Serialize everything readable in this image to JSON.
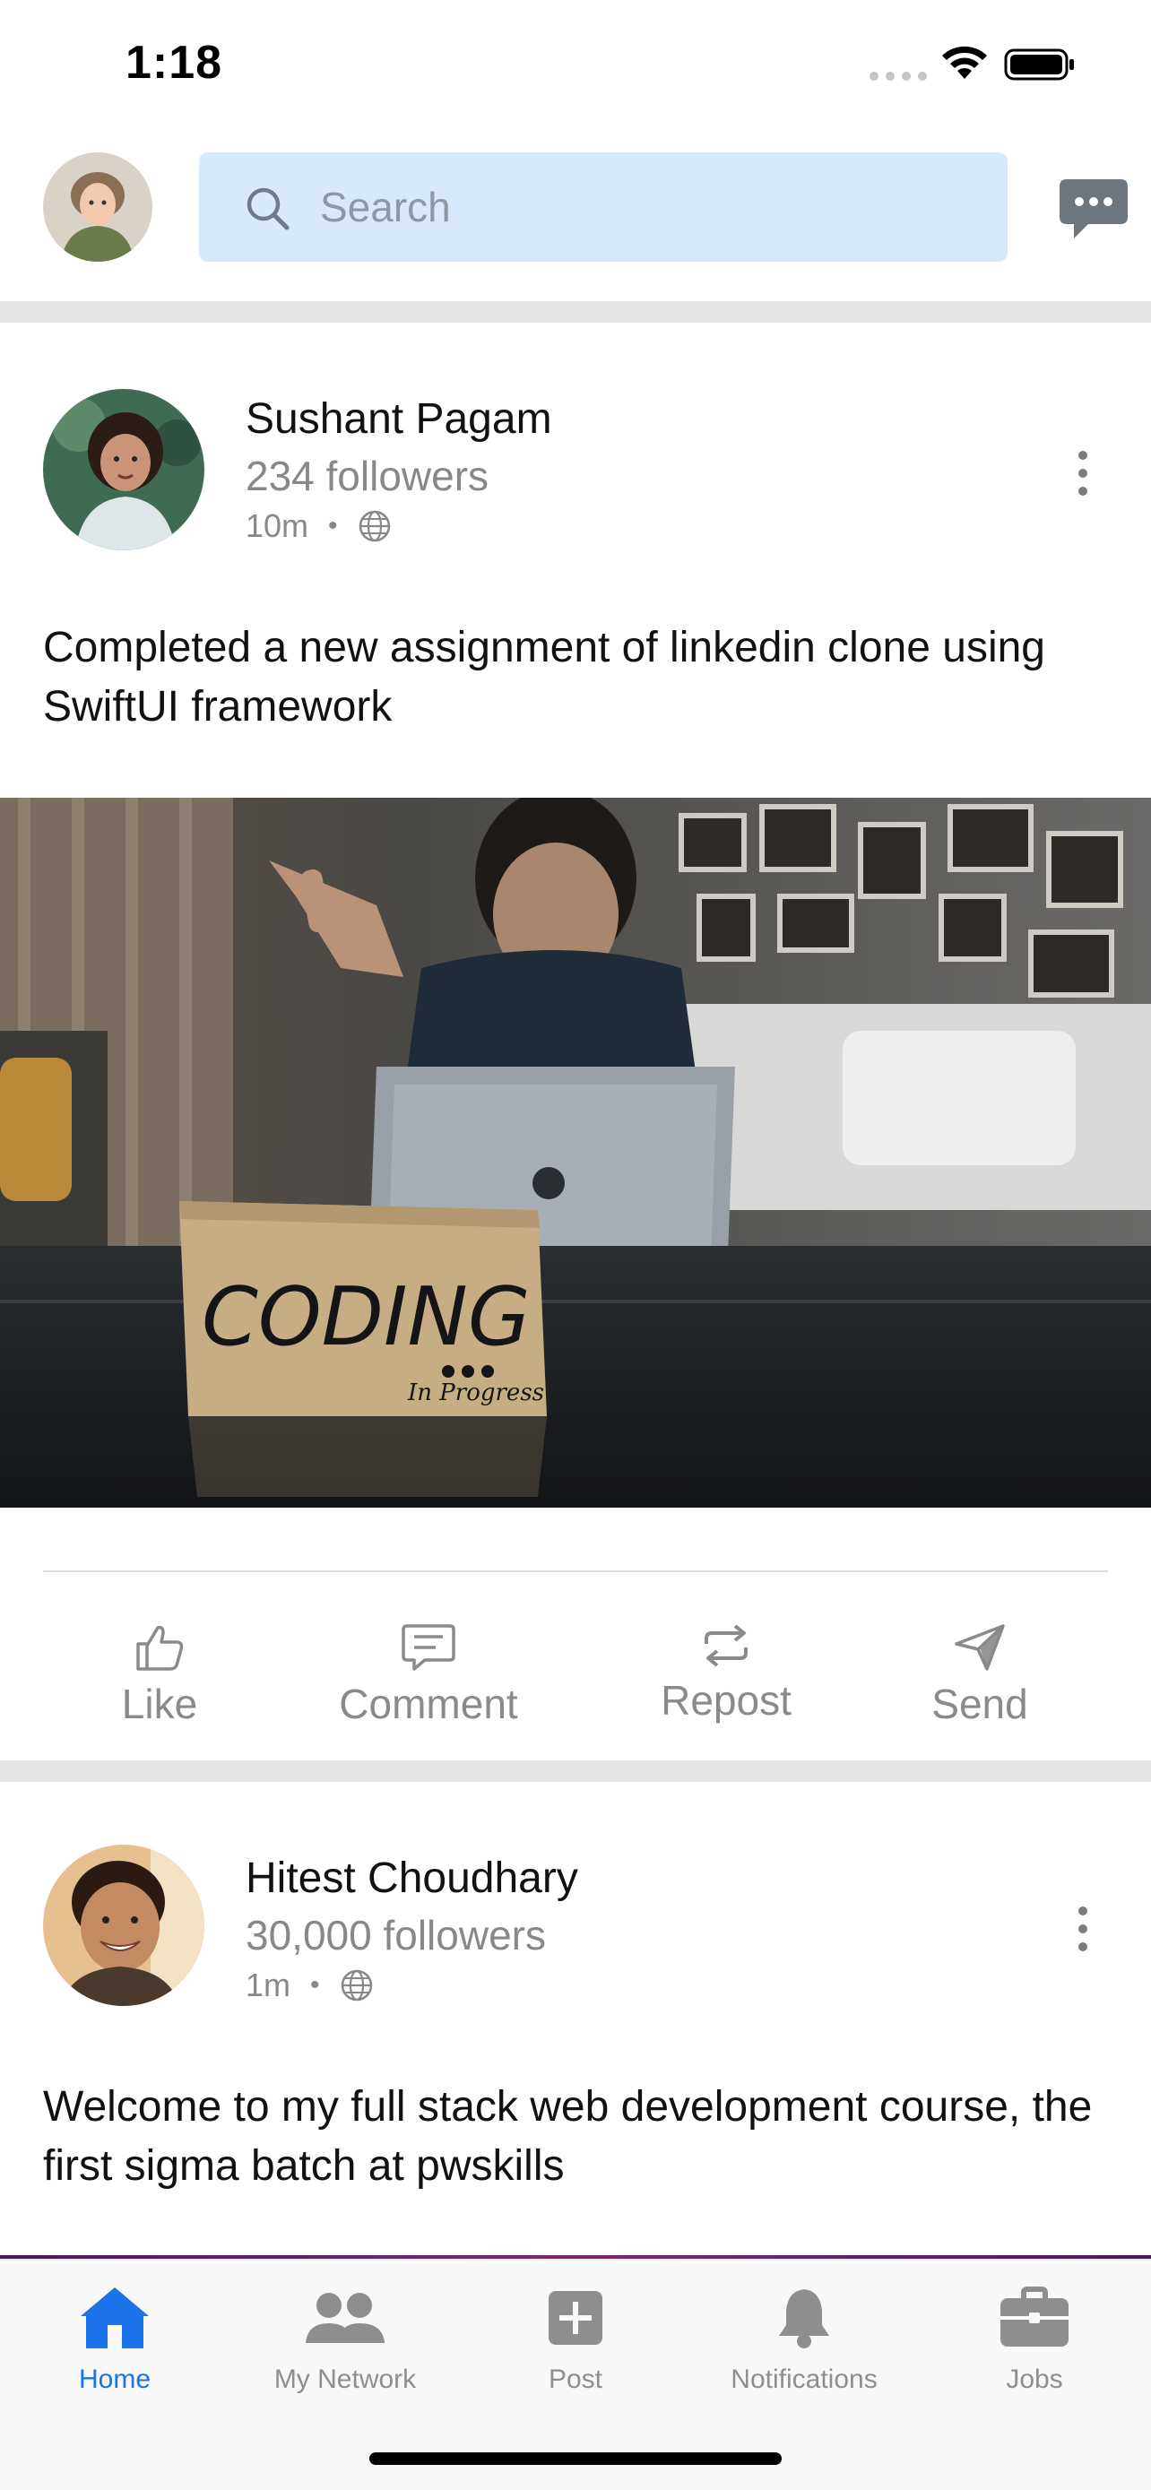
{
  "status_bar": {
    "time": "1:18",
    "wifi_icon": "wifi-icon",
    "battery_icon": "battery-icon"
  },
  "header": {
    "search_placeholder": "Search",
    "search_icon": "search-icon",
    "message_icon": "message-icon"
  },
  "posts": [
    {
      "author": "Sushant Pagam",
      "followers": "234 followers",
      "time": "10m",
      "visibility_icon": "globe-icon",
      "text": "Completed a new assignment of linkedin clone using SwiftUI framework",
      "image_sign_text": "CODING",
      "image_sign_subtext": "In Progress"
    },
    {
      "author": "Hitest Choudhary",
      "followers": "30,000 followers",
      "time": "1m",
      "visibility_icon": "globe-icon",
      "text": "Welcome to my full stack web development course, the first sigma batch at pwskills"
    }
  ],
  "actions": [
    {
      "label": "Like",
      "icon": "thumbs-up-icon"
    },
    {
      "label": "Comment",
      "icon": "comment-icon"
    },
    {
      "label": "Repost",
      "icon": "repost-icon"
    },
    {
      "label": "Send",
      "icon": "send-icon"
    }
  ],
  "tabs": [
    {
      "label": "Home",
      "icon": "home-icon",
      "active": true
    },
    {
      "label": "My Network",
      "icon": "people-icon",
      "active": false
    },
    {
      "label": "Post",
      "icon": "plus-square-icon",
      "active": false
    },
    {
      "label": "Notifications",
      "icon": "bell-icon",
      "active": false
    },
    {
      "label": "Jobs",
      "icon": "briefcase-icon",
      "active": false
    }
  ],
  "colors": {
    "accent": "#1a73e8",
    "search_bg": "#d8e9fb",
    "muted_text": "#888888",
    "divider": "#e6e6e6"
  }
}
